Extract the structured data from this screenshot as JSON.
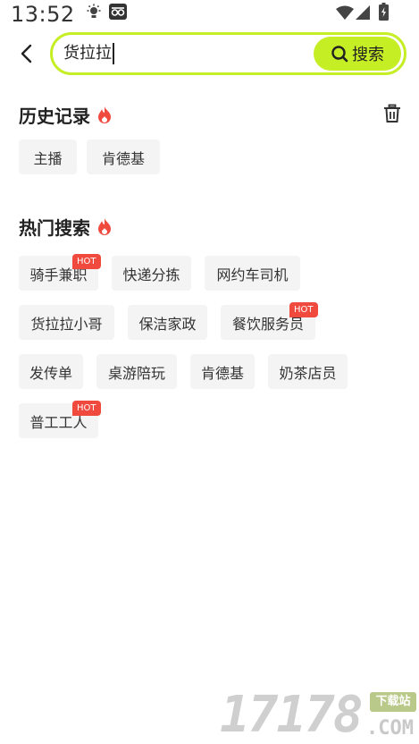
{
  "status_bar": {
    "time": "13:52"
  },
  "search": {
    "query": "货拉拉",
    "button_label": "搜索"
  },
  "history": {
    "title": "历史记录",
    "items": [
      "主播",
      "肯德基"
    ]
  },
  "hot_search": {
    "title": "热门搜索",
    "hot_badge": "HOT",
    "items": [
      "骑手兼职",
      "快递分拣",
      "网约车司机",
      "货拉拉小哥",
      "保洁家政",
      "餐饮服务员",
      "发传单",
      "桌游陪玩",
      "肯德基",
      "奶茶店员",
      "普工工人"
    ]
  },
  "colors": {
    "accent": "#c6ee25",
    "hot": "#f04a3e",
    "chip_bg": "#f4f4f4"
  },
  "watermark": {
    "digits": "17178",
    "cn": "下载站",
    "com": ".COM"
  }
}
